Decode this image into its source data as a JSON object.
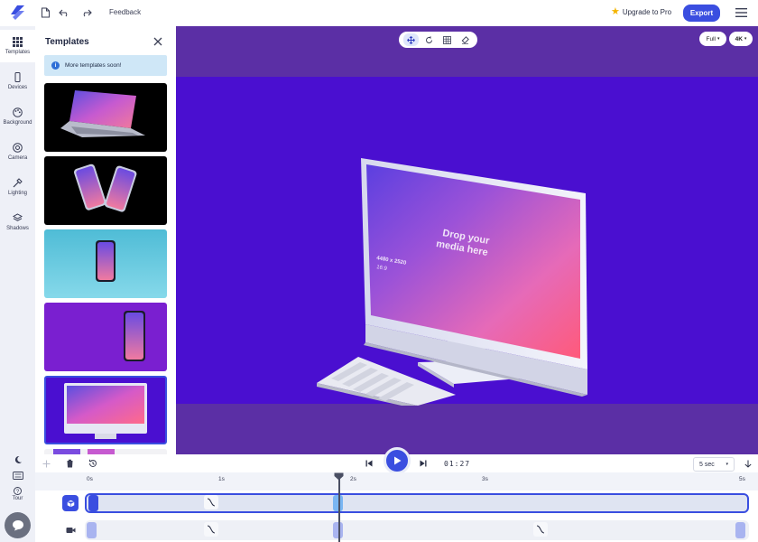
{
  "app": {
    "feedback_label": "Feedback",
    "upgrade_label": "Upgrade to Pro",
    "export_label": "Export",
    "accent_color": "#3a4ee0"
  },
  "rail": {
    "items": [
      {
        "label": "Templates",
        "icon": "grid-icon"
      },
      {
        "label": "Devices",
        "icon": "phone-icon"
      },
      {
        "label": "Background",
        "icon": "palette-icon"
      },
      {
        "label": "Camera",
        "icon": "aperture-icon"
      },
      {
        "label": "Lighting",
        "icon": "wand-icon"
      },
      {
        "label": "Shadows",
        "icon": "layers-icon"
      }
    ],
    "tour_label": "Tour"
  },
  "panel": {
    "title": "Templates",
    "notice": "More templates soon!"
  },
  "canvas": {
    "view_mode": "Full",
    "resolution": "4K",
    "screen_title": "Drop your media here",
    "screen_size": "4480 x 2520",
    "screen_ratio": "16:9"
  },
  "timeline": {
    "time": "01:27",
    "duration": "5 sec",
    "ticks": [
      "0s",
      "1s",
      "2s",
      "3s",
      "5s"
    ],
    "playhead_seconds": 1.87
  }
}
